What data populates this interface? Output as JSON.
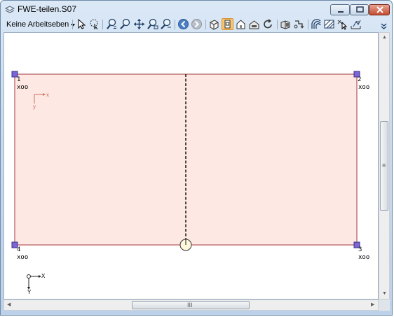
{
  "window": {
    "title": "FWE-teilen.S07"
  },
  "toolbar": {
    "workplane_dropdown": "Keine Arbeitseben",
    "buttons": [
      {
        "icon": "pointer-icon"
      },
      {
        "icon": "lasso-select-icon"
      },
      {
        "icon": "zoom-fit-icon"
      },
      {
        "icon": "zoom-in-icon"
      },
      {
        "icon": "pan-icon"
      },
      {
        "icon": "zoom-window-icon"
      },
      {
        "icon": "zoom-out-icon"
      },
      {
        "icon": "back-icon"
      },
      {
        "icon": "forward-icon"
      },
      {
        "icon": "view-3d-icon"
      },
      {
        "icon": "view-front-icon",
        "active": true
      },
      {
        "icon": "view-house-icon"
      },
      {
        "icon": "view-top-icon"
      },
      {
        "icon": "rotate-icon"
      },
      {
        "icon": "box-view-icon"
      },
      {
        "icon": "sections-icon"
      },
      {
        "icon": "arc-lines-icon"
      },
      {
        "icon": "hatch-icon"
      },
      {
        "icon": "node-cursor-icon"
      },
      {
        "icon": "dimension-icon"
      }
    ]
  },
  "canvas": {
    "nodes": [
      {
        "number": "1",
        "label": "xoo"
      },
      {
        "number": "2",
        "label": "xoo"
      },
      {
        "number": "3",
        "label": "xoo"
      },
      {
        "number": "4",
        "label": "xoo"
      }
    ],
    "local_axes": {
      "x": "x",
      "y": "y"
    },
    "global_axes": {
      "x": "X",
      "y": "Y"
    },
    "colors": {
      "panel_fill": "#fde8e4",
      "panel_edge": "#b4565a",
      "node_fill": "#7b66d6",
      "local_axis": "#d07060"
    }
  },
  "scrollbars": {
    "grip": "III",
    "grip_vertical": "≡"
  }
}
